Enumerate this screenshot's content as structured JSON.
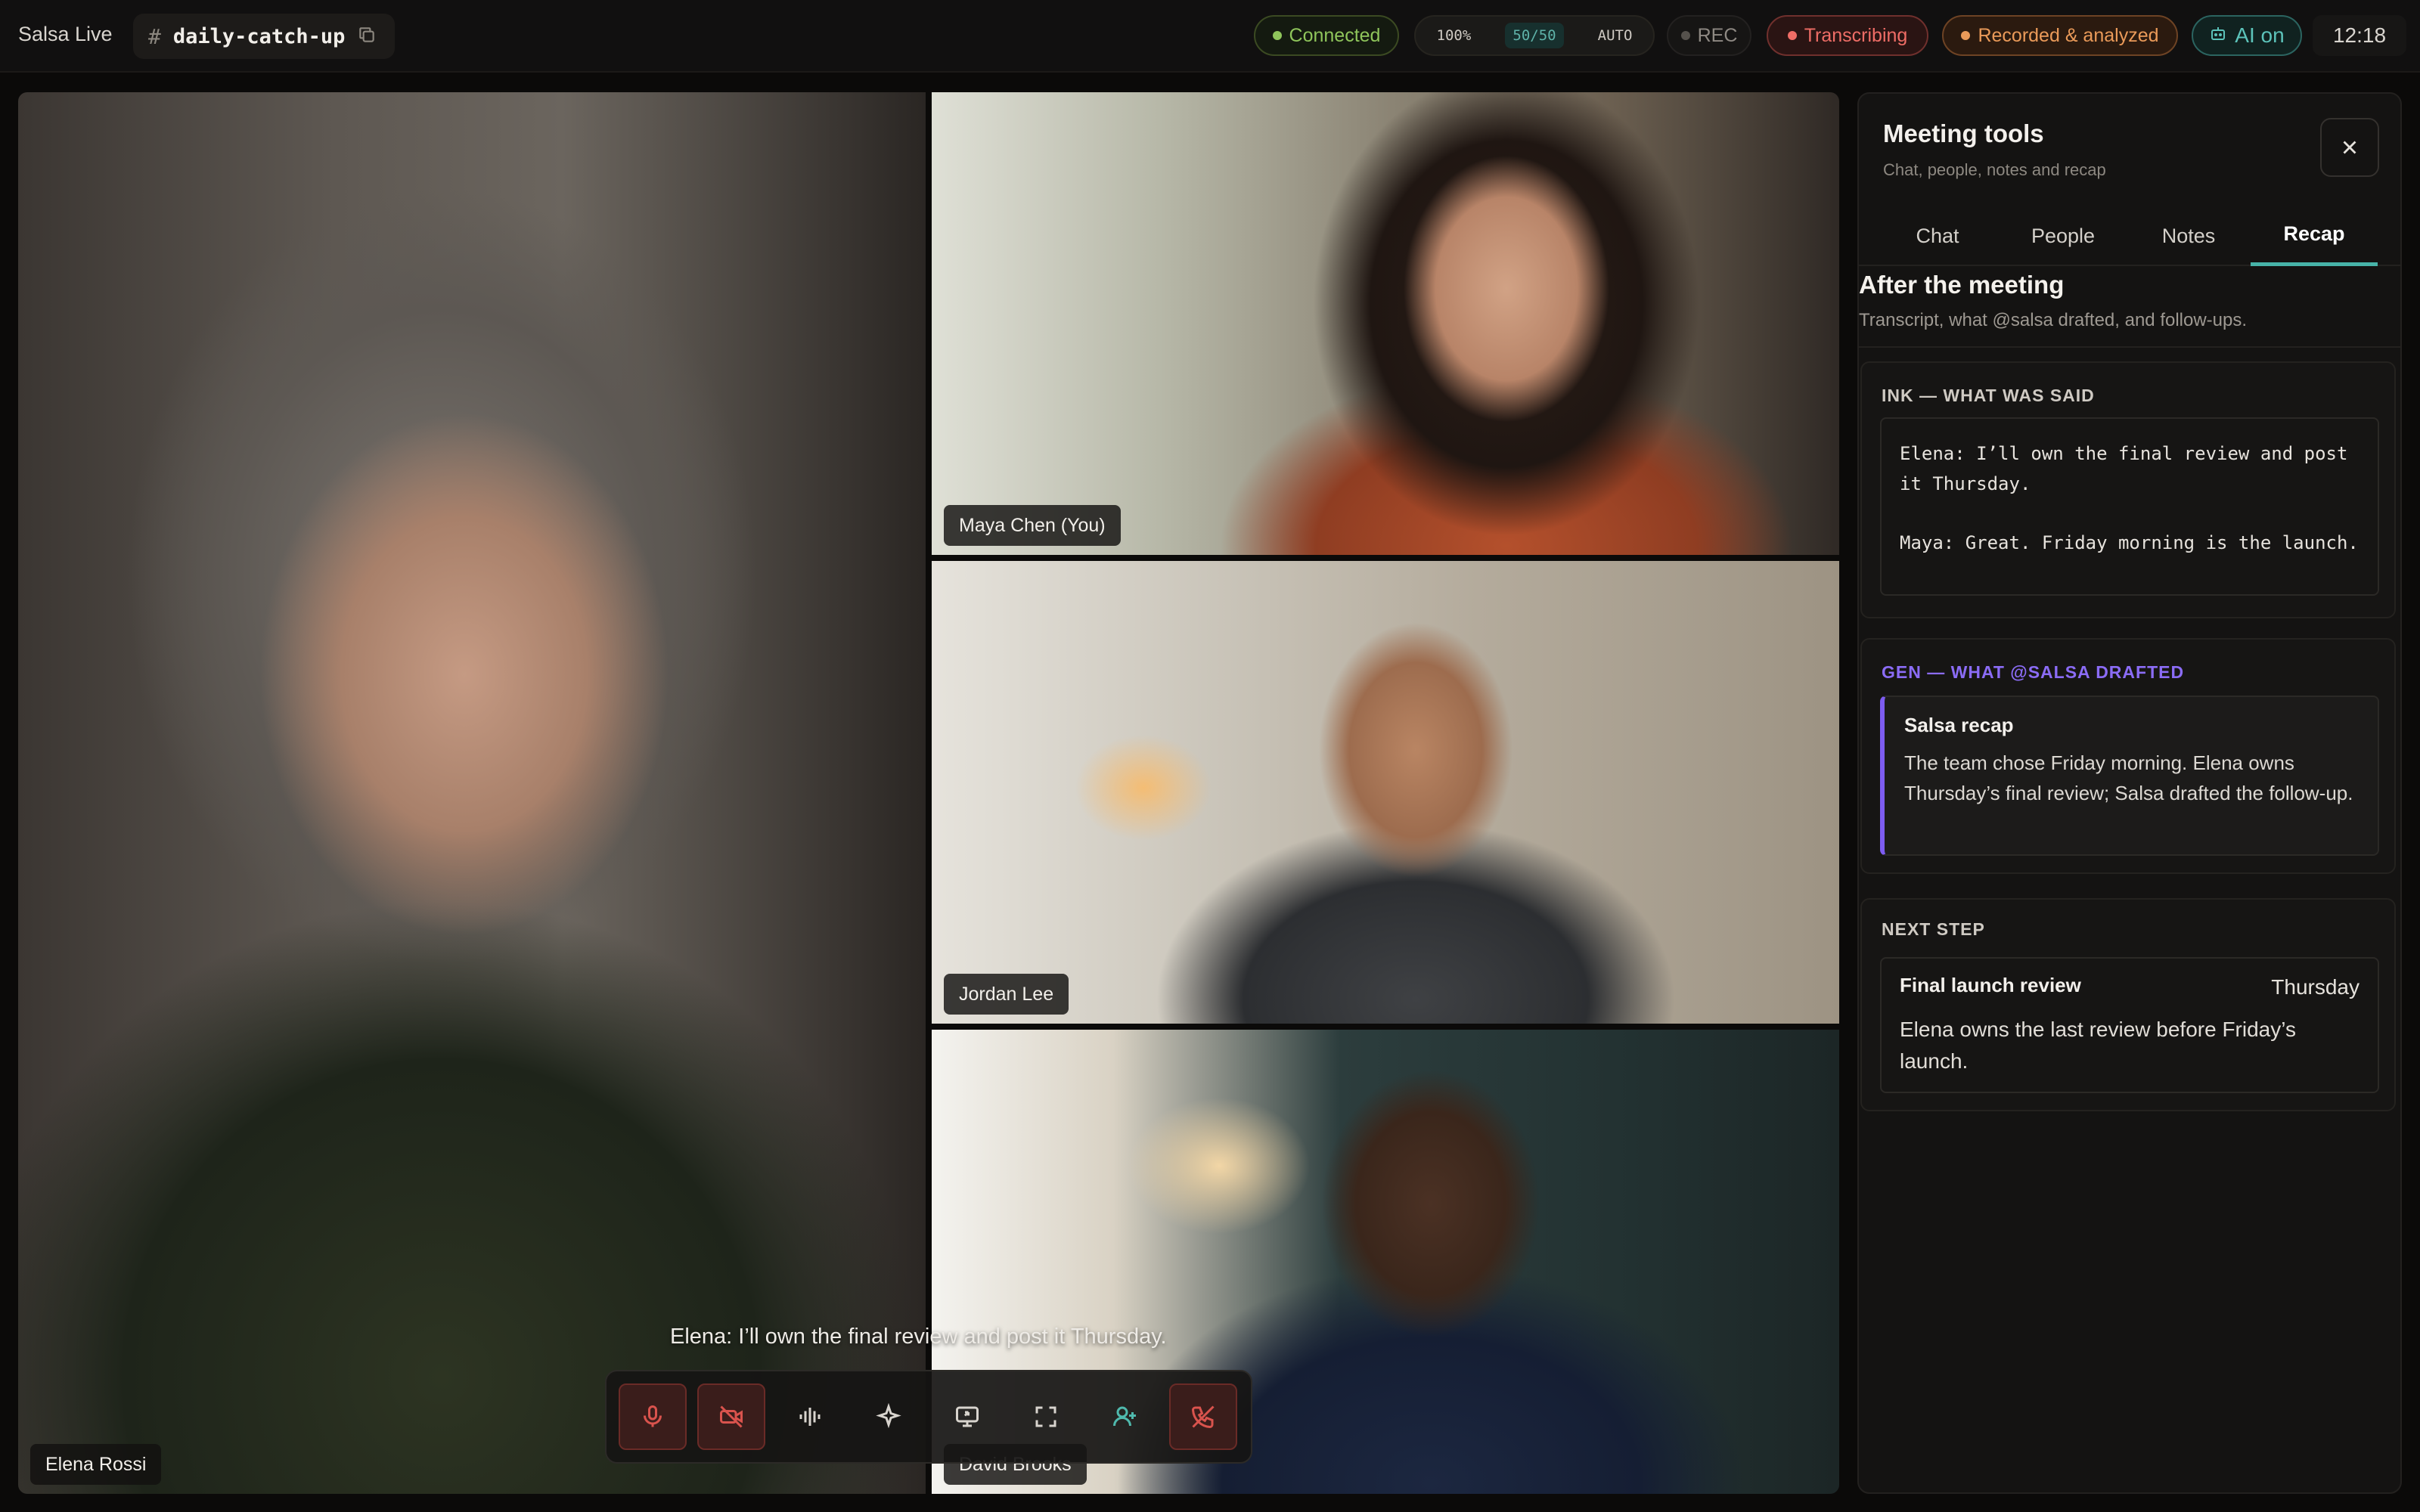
{
  "header": {
    "app_title": "Salsa Live",
    "channel_hash": "#",
    "channel_name": "daily-catch-up",
    "status_connected": "Connected",
    "stats": {
      "zoom": "100%",
      "participants": "50/50",
      "mode": "AUTO"
    },
    "rec_label": "REC",
    "transcribing_label": "Transcribing",
    "recorded_label": "Recorded & analyzed",
    "ai_label": "AI on",
    "clock": "12:18"
  },
  "participants": {
    "elena": "Elena Rossi",
    "maya": "Maya Chen (You)",
    "jordan": "Jordan Lee",
    "david": "David Brooks"
  },
  "caption": "Elena: I’ll own the final review and post it Thursday.",
  "controls": [
    "mic-muted",
    "camera-off",
    "audio-waveform",
    "ai-sparkle",
    "screen-share",
    "fullscreen",
    "add-person",
    "leave-call"
  ],
  "panel": {
    "title": "Meeting tools",
    "subtitle": "Chat, people, notes and recap",
    "tabs": [
      "Chat",
      "People",
      "Notes",
      "Recap"
    ],
    "active_tab": "Recap",
    "section_title": "After the meeting",
    "section_subtitle": "Transcript, what @salsa drafted, and follow-ups.",
    "ink": {
      "label": "INK — WHAT WAS SAID",
      "lines": [
        "Elena: I’ll own the final review and post it Thursday.",
        "Maya: Great. Friday morning is the launch."
      ]
    },
    "gen": {
      "label": "GEN — WHAT @SALSA DRAFTED",
      "title": "Salsa recap",
      "body": "The team chose Friday morning. Elena owns Thursday’s final review; Salsa drafted the follow-up."
    },
    "next_step": {
      "label": "NEXT STEP",
      "title": "Final launch review",
      "due": "Thursday",
      "body": "Elena owns the last review before Friday’s launch."
    }
  },
  "colors": {
    "accent_teal": "#47b3a8",
    "gen_purple": "#7d5cf0",
    "danger_red": "#ef6d66",
    "connected_green": "#8fc55b"
  }
}
